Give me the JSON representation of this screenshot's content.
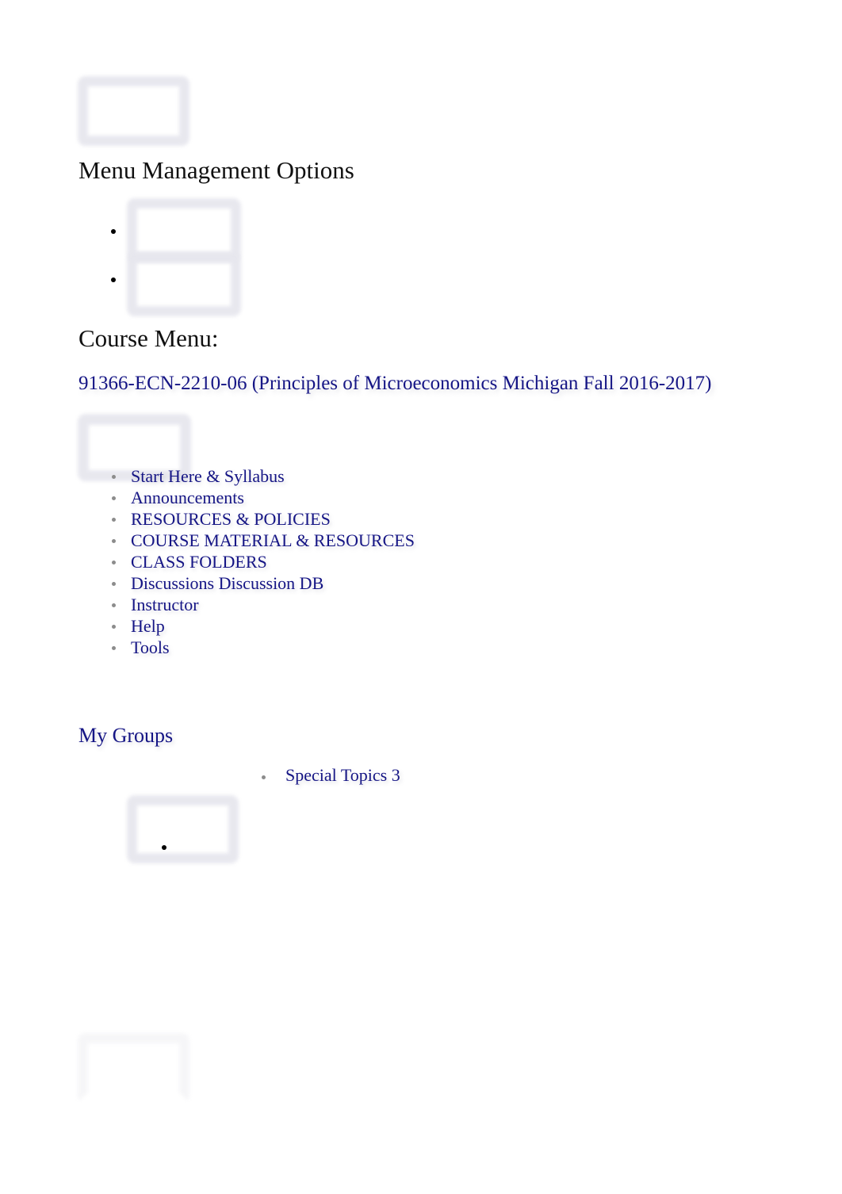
{
  "document": {
    "headings": {
      "menu_management": "Menu Management Options",
      "course_menu": "Course Menu:",
      "my_groups": "My Groups"
    },
    "course": {
      "title_link": "91366-ECN-2210-06 (Principles of Microeconomics Michigan Fall 2016-2017)"
    },
    "course_menu_items": [
      {
        "label": "Start Here & Syllabus"
      },
      {
        "label": "Announcements"
      },
      {
        "label": "RESOURCES & POLICIES"
      },
      {
        "label": "COURSE MATERIAL & RESOURCES"
      },
      {
        "label": "CLASS FOLDERS"
      },
      {
        "label": "Discussions Discussion DB"
      },
      {
        "label": "Instructor"
      },
      {
        "label": "Help"
      },
      {
        "label": "Tools"
      }
    ],
    "groups": [
      {
        "label": "Special Topics 3"
      }
    ],
    "image_placeholders": [
      {
        "name": "broken-image-top"
      },
      {
        "name": "broken-image-menu-option-1"
      },
      {
        "name": "broken-image-menu-option-2"
      },
      {
        "name": "broken-image-course-menu"
      },
      {
        "name": "broken-image-my-groups"
      },
      {
        "name": "broken-image-bottom"
      }
    ],
    "colors": {
      "link": "#151585",
      "heading": "#101010",
      "bullet": "#8c8c8c",
      "placeholder_border": "#e7e7ee",
      "background": "#ffffff"
    }
  }
}
